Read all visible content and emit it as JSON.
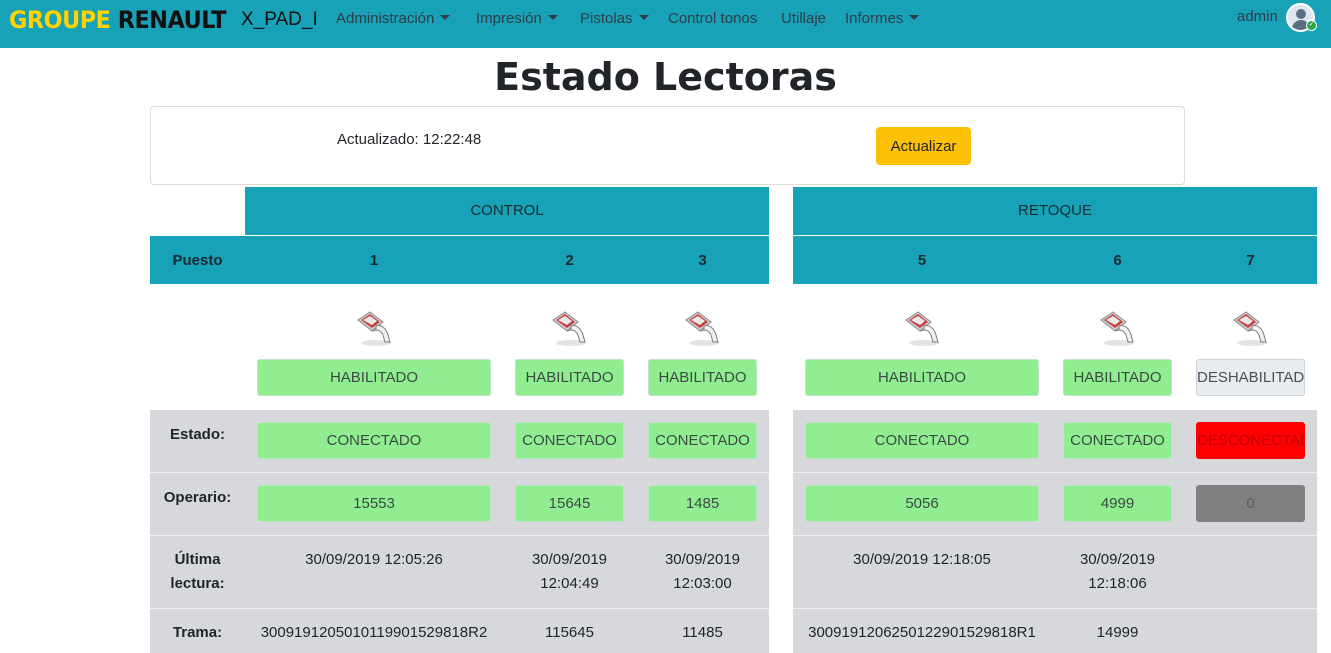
{
  "navbar": {
    "brand_part1": "GROUPE",
    "brand_part2": "RENAULT",
    "app_name": "X_PAD_I",
    "menu": [
      {
        "label": "Administración",
        "dropdown": true
      },
      {
        "label": "Impresión",
        "dropdown": true
      },
      {
        "label": "Pistolas",
        "dropdown": true
      },
      {
        "label": "Control tonos",
        "dropdown": false
      },
      {
        "label": "Utillaje",
        "dropdown": false
      },
      {
        "label": "Informes",
        "dropdown": true
      }
    ],
    "user": "admin"
  },
  "page": {
    "title": "Estado Lectoras",
    "updated_label": "Actualizado: 12:22:48",
    "refresh_button": "Actualizar"
  },
  "groups": {
    "control": "CONTROL",
    "retoque": "RETOQUE"
  },
  "row_labels": {
    "puesto": "Puesto",
    "estado": "Estado:",
    "operario": "Operario:",
    "ultima_line1": "Última",
    "ultima_line2": "lectura:",
    "trama": "Trama:"
  },
  "readers": [
    {
      "puesto": "1",
      "habilitado": "HABILITADO",
      "estado": "CONECTADO",
      "operario": "15553",
      "ultima_1": "30/09/2019 12:05:26",
      "ultima_2": "",
      "trama": "3009191205010119901529818R2"
    },
    {
      "puesto": "2",
      "habilitado": "HABILITADO",
      "estado": "CONECTADO",
      "operario": "15645",
      "ultima_1": "30/09/2019",
      "ultima_2": "12:04:49",
      "trama": "115645"
    },
    {
      "puesto": "3",
      "habilitado": "HABILITADO",
      "estado": "CONECTADO",
      "operario": "1485",
      "ultima_1": "30/09/2019",
      "ultima_2": "12:03:00",
      "trama": "11485"
    },
    {
      "puesto": "5",
      "habilitado": "HABILITADO",
      "estado": "CONECTADO",
      "operario": "5056",
      "ultima_1": "30/09/2019 12:18:05",
      "ultima_2": "",
      "trama": "3009191206250122901529818R1"
    },
    {
      "puesto": "6",
      "habilitado": "HABILITADO",
      "estado": "CONECTADO",
      "operario": "4999",
      "ultima_1": "30/09/2019",
      "ultima_2": "12:18:06",
      "trama": "14999"
    },
    {
      "puesto": "7",
      "habilitado": "DESHABILITADO",
      "estado": "DESCONECTADO",
      "operario": "0",
      "ultima_1": "",
      "ultima_2": "",
      "trama": ""
    }
  ],
  "colors": {
    "navbar": "#17a2b8",
    "enabled": "#90ee90",
    "disconnected": "#ff0000",
    "button": "#ffc107",
    "row_grey": "#d6d8dc"
  },
  "icons": {
    "reader": "barcode-scanner-icon",
    "avatar": "user-avatar-icon"
  }
}
